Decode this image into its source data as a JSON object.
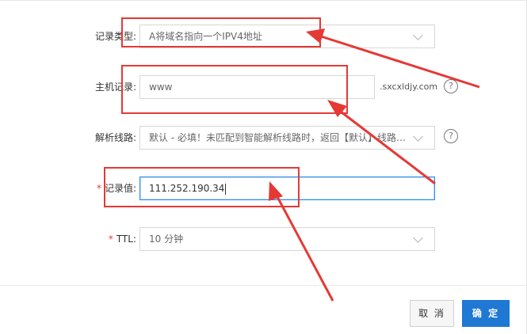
{
  "form": {
    "record_type": {
      "label": "记录类型:",
      "value": "A将域名指向一个IPV4地址"
    },
    "host": {
      "label": "主机记录:",
      "value": "www",
      "suffix": ".sxcxldjy.com"
    },
    "line": {
      "label": "解析线路:",
      "value": "默认 - 必填！未匹配到智能解析线路时，返回【默认】线路设..."
    },
    "record_value": {
      "required_mark": "*",
      "label": "记录值:",
      "value": "111.252.190.34"
    },
    "ttl": {
      "required_mark": "*",
      "label": "TTL:",
      "value": "10 分钟"
    },
    "help_symbol": "?"
  },
  "footer": {
    "cancel_label": "取 消",
    "confirm_label": "确 定"
  },
  "colors": {
    "annotation_red": "#e53935",
    "focus_blue": "#2f8be8",
    "primary_button": "#1e78d4"
  }
}
